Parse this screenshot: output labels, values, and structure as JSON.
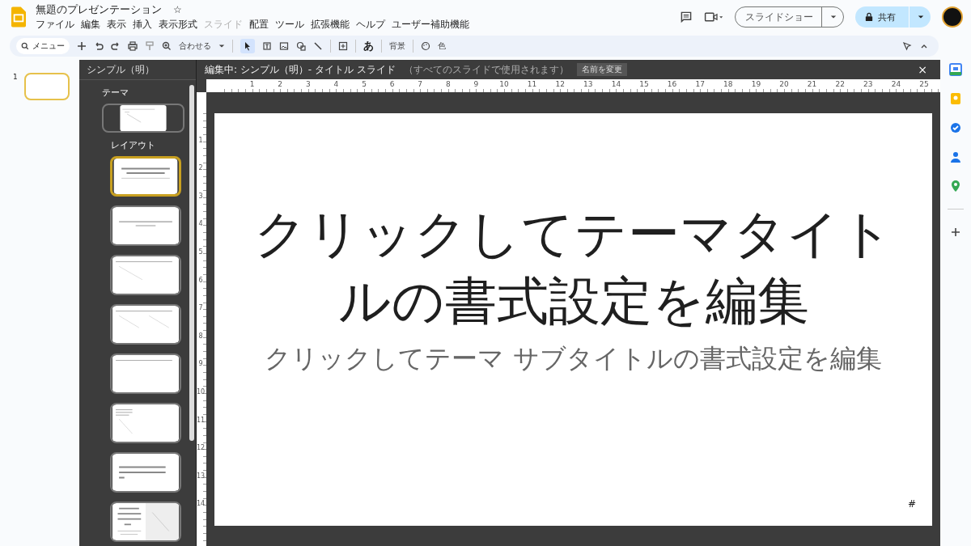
{
  "app": {
    "title": "無題のプレゼンテーション",
    "star": "☆",
    "menu": [
      {
        "label": "ファイル",
        "disabled": false
      },
      {
        "label": "編集",
        "disabled": false
      },
      {
        "label": "表示",
        "disabled": false
      },
      {
        "label": "挿入",
        "disabled": false
      },
      {
        "label": "表示形式",
        "disabled": false
      },
      {
        "label": "スライド",
        "disabled": true
      },
      {
        "label": "配置",
        "disabled": false
      },
      {
        "label": "ツール",
        "disabled": false
      },
      {
        "label": "拡張機能",
        "disabled": false
      },
      {
        "label": "ヘルプ",
        "disabled": false
      },
      {
        "label": "ユーザー補助機能",
        "disabled": false
      }
    ],
    "slideshow": "スライドショー",
    "share": "共有"
  },
  "toolbar": {
    "search": "メニュー",
    "zoom": "合わせる",
    "text_style": "あ",
    "background": "背景",
    "color_label": "色"
  },
  "filmstrip": [
    {
      "number": "1",
      "selected": true
    }
  ],
  "theme_panel": {
    "title": "シンプル（明）",
    "theme_heading": "テーマ",
    "layout_heading": "レイアウト",
    "layouts": [
      {
        "kind": "title",
        "selected": true
      },
      {
        "kind": "section",
        "selected": false
      },
      {
        "kind": "body",
        "selected": false
      },
      {
        "kind": "columns",
        "selected": false
      },
      {
        "kind": "title_only",
        "selected": false
      },
      {
        "kind": "caption",
        "selected": false
      },
      {
        "kind": "main_point",
        "selected": false
      },
      {
        "kind": "split",
        "selected": false
      }
    ]
  },
  "editor": {
    "heading": "編集中: シンプル（明）- タイトル スライド",
    "note": "（すべてのスライドで使用されます）",
    "rename": "名前を変更",
    "close": "×",
    "hruler": [
      "1",
      "2",
      "3",
      "4",
      "5",
      "6",
      "7",
      "8",
      "9",
      "10",
      "11",
      "12",
      "13",
      "14",
      "15",
      "16",
      "17",
      "18",
      "19",
      "20",
      "21",
      "22",
      "23",
      "24",
      "25"
    ],
    "vruler": [
      "1",
      "2",
      "3",
      "4",
      "5",
      "6",
      "7",
      "8",
      "9",
      "10",
      "11",
      "12",
      "13",
      "14"
    ],
    "slide": {
      "title": "クリックしてテーマタイトルの書式設定を編集",
      "subtitle": "クリックしてテーマ サブタイトルの書式設定を編集",
      "number": "#"
    }
  }
}
